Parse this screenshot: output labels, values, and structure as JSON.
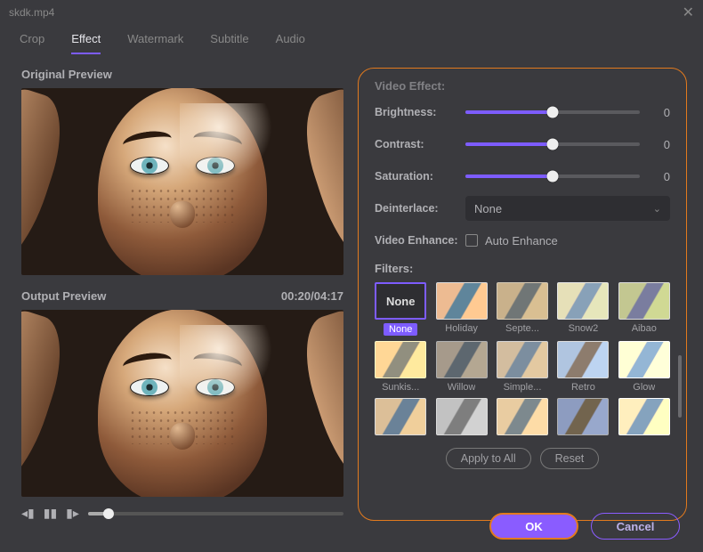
{
  "window": {
    "title": "skdk.mp4"
  },
  "tabs": {
    "items": [
      "Crop",
      "Effect",
      "Watermark",
      "Subtitle",
      "Audio"
    ],
    "active": "Effect"
  },
  "previews": {
    "original_label": "Original Preview",
    "output_label": "Output Preview",
    "timecode": "00:20/04:17"
  },
  "effects": {
    "header": "Video Effect:",
    "brightness": {
      "label": "Brightness:",
      "value": 0,
      "percent": 50
    },
    "contrast": {
      "label": "Contrast:",
      "value": 0,
      "percent": 50
    },
    "saturation": {
      "label": "Saturation:",
      "value": 0,
      "percent": 50
    },
    "deinterlace": {
      "label": "Deinterlace:",
      "selected": "None"
    },
    "enhance": {
      "label": "Video Enhance:",
      "checkbox_label": "Auto Enhance",
      "checked": false
    },
    "filters_label": "Filters:",
    "filters": [
      {
        "name": "None",
        "selected": true
      },
      {
        "name": "Holiday"
      },
      {
        "name": "Septe..."
      },
      {
        "name": "Snow2"
      },
      {
        "name": "Aibao"
      },
      {
        "name": "Sunkis..."
      },
      {
        "name": "Willow"
      },
      {
        "name": "Simple..."
      },
      {
        "name": "Retro"
      },
      {
        "name": "Glow"
      },
      {
        "name": ""
      },
      {
        "name": ""
      },
      {
        "name": ""
      },
      {
        "name": ""
      },
      {
        "name": ""
      }
    ],
    "apply_all": "Apply to All",
    "reset": "Reset"
  },
  "dialog": {
    "ok": "OK",
    "cancel": "Cancel"
  }
}
